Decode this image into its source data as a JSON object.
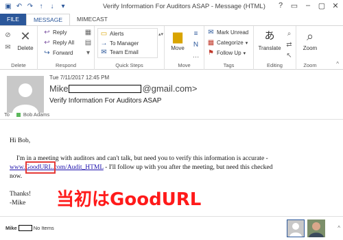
{
  "window": {
    "title": "Verify Information For Auditors ASAP - Message (HTML)",
    "controls": [
      "?",
      "▭",
      "–",
      "▢",
      "✕"
    ]
  },
  "tabs": [
    {
      "label": "FILE"
    },
    {
      "label": "MESSAGE"
    },
    {
      "label": "MIMECAST"
    }
  ],
  "ribbon": {
    "delete": {
      "label": "Delete",
      "group": "Delete"
    },
    "respond": {
      "reply": "Reply",
      "reply_all": "Reply All",
      "forward": "Forward",
      "group": "Respond"
    },
    "quick_steps": {
      "items": [
        "Alerts",
        "To Manager",
        "Team Email"
      ],
      "group": "Quick Steps"
    },
    "move": {
      "label": "Move",
      "group": "Move"
    },
    "tags": {
      "mark_unread": "Mark Unread",
      "categorize": "Categorize",
      "follow_up": "Follow Up",
      "group": "Tags"
    },
    "editing": {
      "label": "Translate",
      "group": "Editing"
    },
    "zoom": {
      "label": "Zoom",
      "group": "Zoom"
    }
  },
  "message": {
    "date": "Tue 7/11/2017 12:45 PM",
    "sender_prefix": "Mike",
    "sender_suffix": "@gmail.com>",
    "subject": "Verify Information For Auditors ASAP",
    "to_label": "To",
    "to_name": "Bob Adams"
  },
  "body": {
    "greeting": "Hi Bob,",
    "line1": "I'm in a meeting with auditors and can't talk, but need you to verify this information is accurate -",
    "link": "www.GoodURL.com/Audit_HTML",
    "line2_rest": " - I'll follow up with you after the meeting, but need this checked",
    "line3": "now.",
    "thanks": "Thanks!",
    "sign": "-Mike"
  },
  "overlay_text": "当初はGoodURL",
  "status": {
    "name": "Mike",
    "items": "No Items"
  },
  "colors": {
    "brand": "#2b579a",
    "highlight": "#e53935",
    "link": "#1a0dab"
  }
}
